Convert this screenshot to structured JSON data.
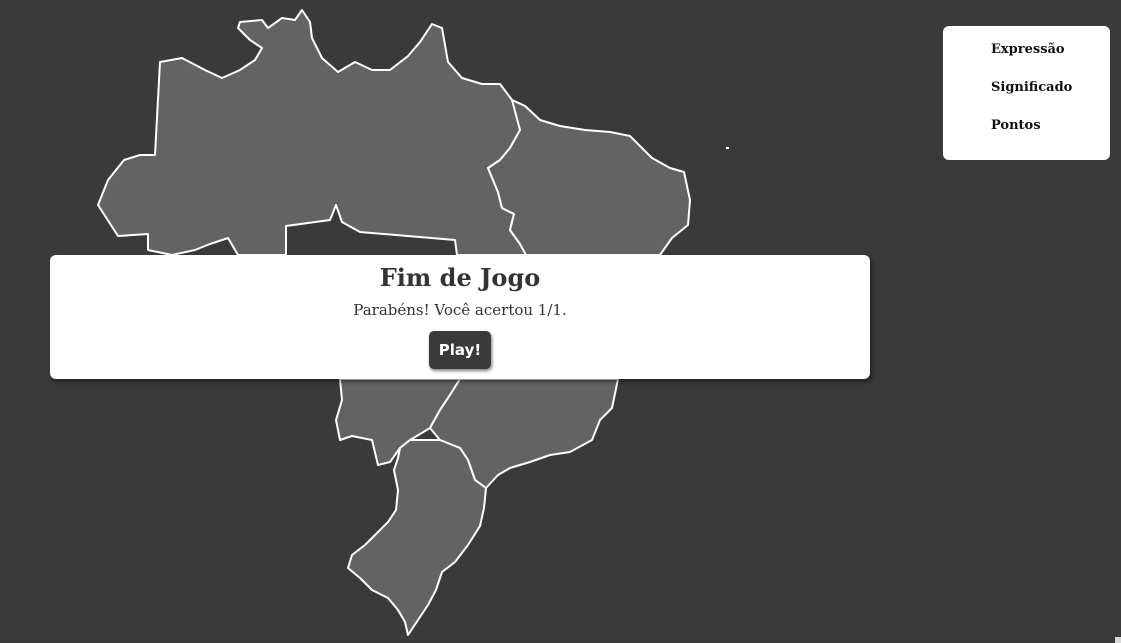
{
  "info_panel": {
    "items": [
      "Expressão",
      "Significado",
      "Pontos"
    ]
  },
  "modal": {
    "title": "Fim de Jogo",
    "message": "Parabéns! Você acertou 1/1.",
    "play_label": "Play!"
  },
  "map": {
    "regions": [
      "north",
      "northeast",
      "central-west",
      "southeast",
      "south"
    ],
    "region_fill": "#636363",
    "border_color": "#ffffff",
    "background": "#3a3a3a"
  }
}
